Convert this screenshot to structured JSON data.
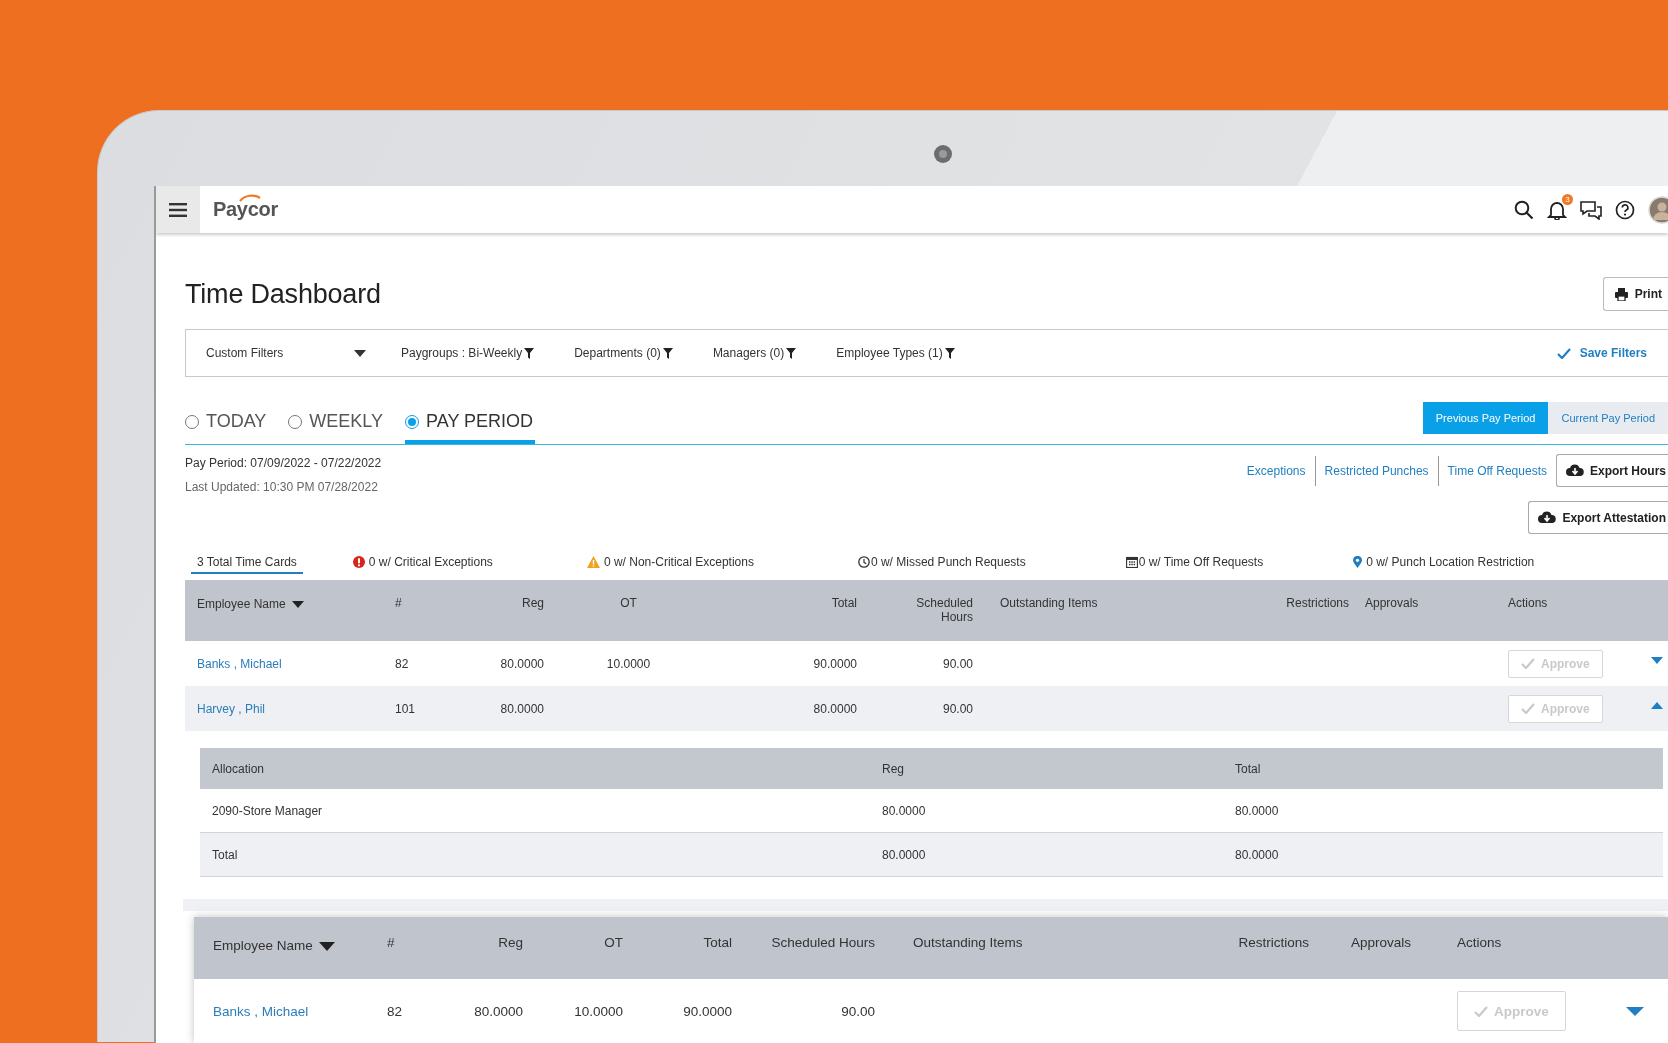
{
  "app": {
    "logo": "Paycor",
    "notification_count": "3"
  },
  "page": {
    "title": "Time Dashboard",
    "print_button": "Print"
  },
  "filters": {
    "custom_filters": "Custom Filters",
    "items": [
      "Paygroups : Bi-Weekly",
      "Departments (0)",
      "Managers (0)",
      "Employee Types (1)"
    ],
    "save": "Save Filters"
  },
  "range_options": [
    {
      "label": "TODAY",
      "selected": false
    },
    {
      "label": "WEEKLY",
      "selected": false
    },
    {
      "label": "PAY PERIOD",
      "selected": true
    }
  ],
  "pay_period_buttons": [
    {
      "label": "Previous Pay Period",
      "selected": true
    },
    {
      "label": "Current Pay Period",
      "selected": false
    }
  ],
  "pay_period": "Pay Period: 07/09/2022 - 07/22/2022",
  "last_updated": "Last Updated: 10:30 PM 07/28/2022",
  "links": [
    "Exceptions",
    "Restricted Punches",
    "Time Off Requests"
  ],
  "export_buttons": [
    "Export Hours",
    "Export Attestation"
  ],
  "summary_tabs": [
    {
      "kind": "total",
      "label": "3 Total Time Cards",
      "selected": true
    },
    {
      "kind": "critical",
      "label": "0 w/ Critical Exceptions",
      "selected": false
    },
    {
      "kind": "warning",
      "label": "0 w/ Non-Critical Exceptions",
      "selected": false
    },
    {
      "kind": "missed",
      "label": "0 w/ Missed Punch Requests",
      "selected": false
    },
    {
      "kind": "timeoff",
      "label": "0 w/ Time Off Requests",
      "selected": false
    },
    {
      "kind": "location",
      "label": "0 w/ Punch Location Restriction",
      "selected": false
    }
  ],
  "table": {
    "columns": [
      "Employee Name",
      "#",
      "Reg",
      "OT",
      "Total",
      "Scheduled Hours",
      "Outstanding Items",
      "Restrictions",
      "Approvals",
      "Actions"
    ],
    "rows": [
      {
        "name": "Banks , Michael",
        "number": "82",
        "reg": "80.0000",
        "ot": "10.0000",
        "total": "90.0000",
        "scheduled": "90.00",
        "action": "Approve",
        "disabled": true,
        "expanded": false
      },
      {
        "name": "Harvey , Phil",
        "number": "101",
        "reg": "80.0000",
        "total": "80.0000",
        "scheduled": "90.00",
        "action": "Approve",
        "disabled": true,
        "expanded": true
      }
    ]
  },
  "allocation": {
    "columns": [
      "Allocation",
      "Reg",
      "Total"
    ],
    "rows": [
      {
        "kind": "item",
        "cells": [
          "2090-Store Manager",
          "80.0000",
          "80.0000"
        ]
      },
      {
        "kind": "total",
        "cells": [
          "Total",
          "80.0000",
          "80.0000"
        ]
      }
    ]
  },
  "zoomed_table": {
    "columns": [
      "Employee Name",
      "#",
      "Reg",
      "OT",
      "Total",
      "Scheduled Hours",
      "Outstanding Items",
      "Restrictions",
      "Approvals",
      "Actions"
    ],
    "rows": [
      {
        "name": "Banks , Michael",
        "number": "82",
        "reg": "80.0000",
        "ot": "10.0000",
        "total": "90.0000",
        "scheduled": "90.00",
        "action": "Approve",
        "disabled": true,
        "expanded": false
      }
    ]
  }
}
